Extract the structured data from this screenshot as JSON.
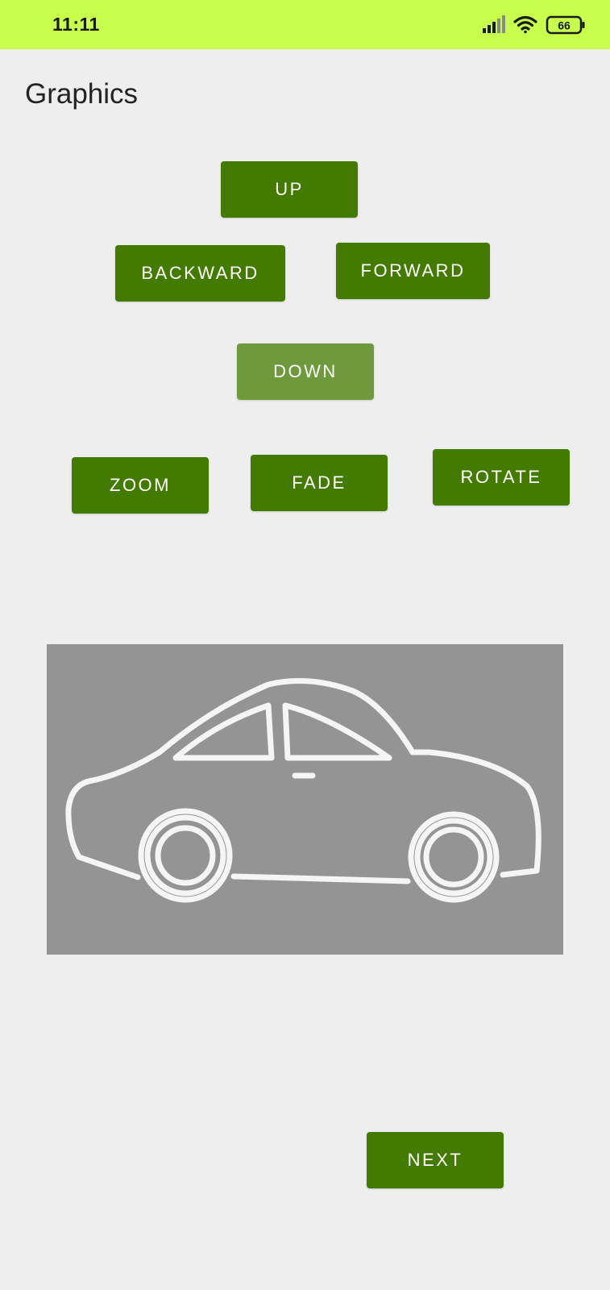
{
  "status_bar": {
    "time": "11:11",
    "battery": "66",
    "background_color": "#c8ff4c",
    "icons": [
      "signal-icon",
      "wifi-icon",
      "battery-icon"
    ]
  },
  "page": {
    "title": "Graphics",
    "background_color": "#eeeeee"
  },
  "buttons": {
    "up": "UP",
    "backward": "BACKWARD",
    "forward": "FORWARD",
    "down": "DOWN",
    "zoom": "ZOOM",
    "fade": "FADE",
    "rotate": "ROTATE",
    "next": "NEXT",
    "color": "#437a00",
    "down_color": "#6e9a3c"
  },
  "image": {
    "subject": "car-outline-icon",
    "background_color": "#949494",
    "stroke_color": "#ffffff"
  }
}
